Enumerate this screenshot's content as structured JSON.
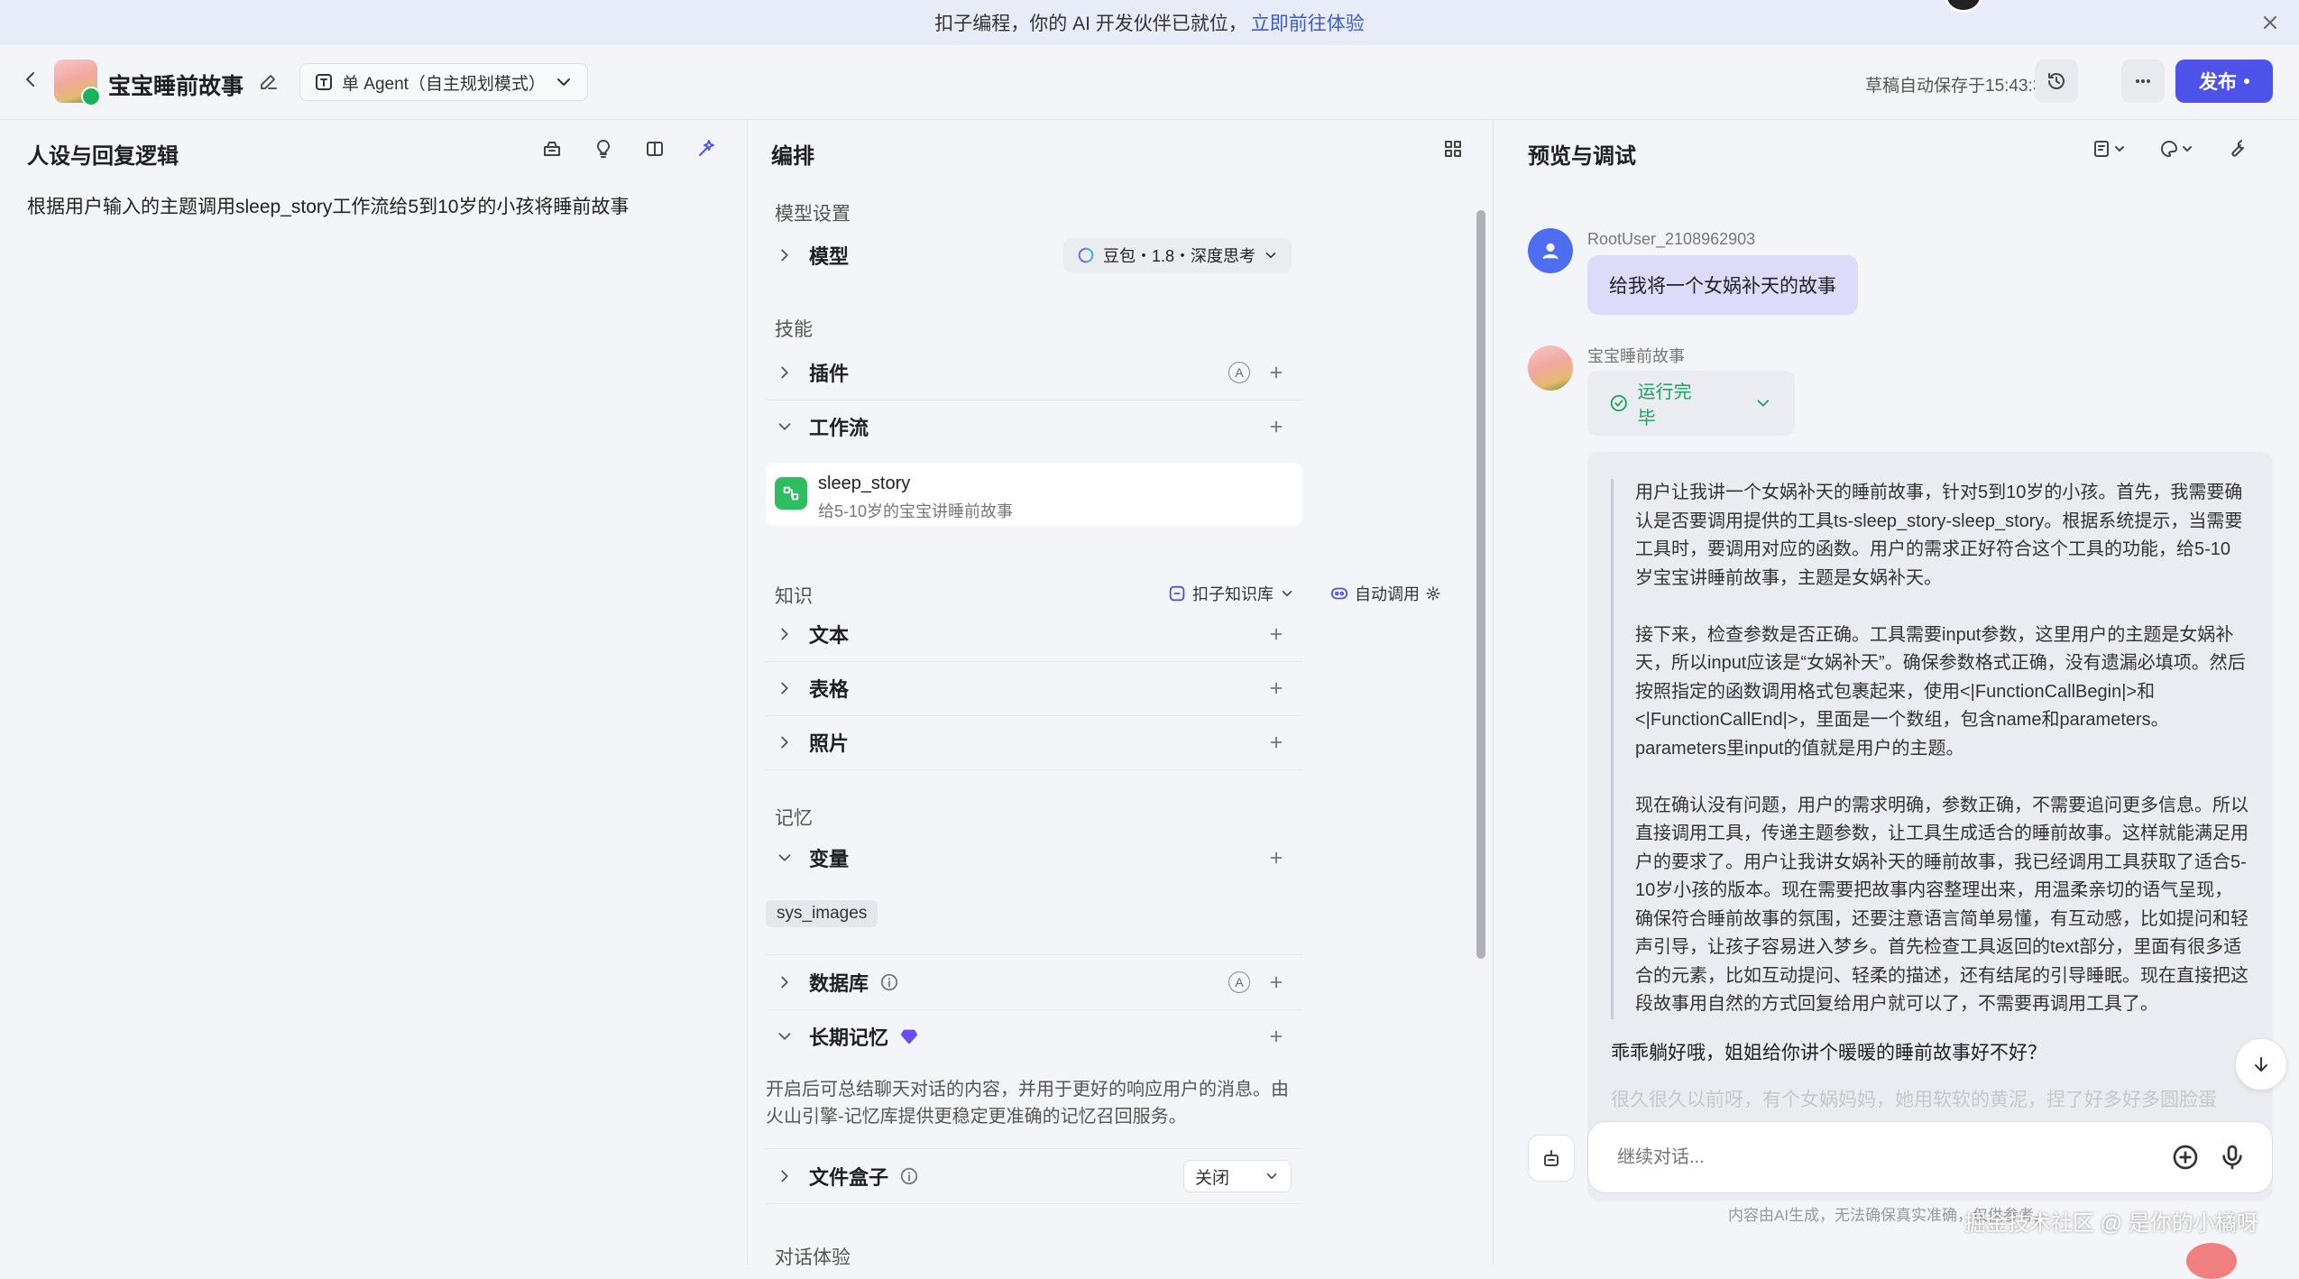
{
  "banner": {
    "text": "扣子编程，你的 AI 开发伙伴已就位，",
    "link": "立即前往体验"
  },
  "header": {
    "bot_name": "宝宝睡前故事",
    "mode": "单 Agent（自主规划模式）",
    "autosave": "草稿自动保存于15:43:34",
    "publish": "发布"
  },
  "persona": {
    "title": "人设与回复逻辑",
    "prompt": "根据用户输入的主题调用sleep_story工作流给5到10岁的小孩将睡前故事"
  },
  "arrange": {
    "title": "编排",
    "model_section": "模型设置",
    "model_label": "模型",
    "model_value": "豆包・1.8・深度思考",
    "skills_section": "技能",
    "plugins_label": "插件",
    "workflow_label": "工作流",
    "workflow": {
      "name": "sleep_story",
      "desc": "给5-10岁的宝宝讲睡前故事"
    },
    "knowledge_section": "知识",
    "kb_source": "扣子知识库",
    "kb_mode": "自动调用",
    "text_label": "文本",
    "table_label": "表格",
    "photo_label": "照片",
    "memory_section": "记忆",
    "variables_label": "变量",
    "variable_chip": "sys_images",
    "database_label": "数据库",
    "ltm_label": "长期记忆",
    "ltm_desc": "开启后可总结聊天对话的内容，并用于更好的响应用户的消息。由火山引擎-记忆库提供更稳定更准确的记忆召回服务。",
    "filebox_label": "文件盒子",
    "filebox_value": "关闭",
    "dialog_section": "对话体验"
  },
  "preview": {
    "title": "预览与调试",
    "user_name": "RootUser_2108962903",
    "user_message": "给我将一个女娲补天的故事",
    "bot_name": "宝宝睡前故事",
    "run_status": "运行完毕",
    "reasoning": [
      "用户让我讲一个女娲补天的睡前故事，针对5到10岁的小孩。首先，我需要确认是否要调用提供的工具ts-sleep_story-sleep_story。根据系统提示，当需要工具时，要调用对应的函数。用户的需求正好符合这个工具的功能，给5-10岁宝宝讲睡前故事，主题是女娲补天。",
      "接下来，检查参数是否正确。工具需要input参数，这里用户的主题是女娲补天，所以input应该是“女娲补天”。确保参数格式正确，没有遗漏必填项。然后按照指定的函数调用格式包裹起来，使用<|FunctionCallBegin|>和<|FunctionCallEnd|>，里面是一个数组，包含name和parameters。parameters里input的值就是用户的主题。",
      "现在确认没有问题，用户的需求明确，参数正确，不需要追问更多信息。所以直接调用工具，传递主题参数，让工具生成适合的睡前故事。这样就能满足用户的要求了。用户让我讲女娲补天的睡前故事，我已经调用工具获取了适合5-10岁小孩的版本。现在需要把故事内容整理出来，用温柔亲切的语气呈现，确保符合睡前故事的氛围，还要注意语言简单易懂，有互动感，比如提问和轻声引导，让孩子容易进入梦乡。首先检查工具返回的text部分，里面有很多适合的元素，比如互动提问、轻柔的描述，还有结尾的引导睡眠。现在直接把这段故事用自然的方式回复给用户就可以了，不需要再调用工具了。"
    ],
    "answer_line_1": "乖乖躺好哦，姐姐给你讲个暖暖的睡前故事好不好？",
    "answer_line_2": "很久很久以前呀，有个女娲妈妈，她用软软的黄泥，捏了好多好多圆脸蛋",
    "input_placeholder": "继续对话...",
    "disclaimer": "内容由AI生成，无法确保真实准确，仅供参考。",
    "watermark": "掘金技术社区 @ 是你的小橘呀"
  },
  "colors": {
    "accent": "#4d53e8",
    "success": "#19a35a",
    "workflow": "#2ebd5f",
    "user_avatar": "#4d6ef0"
  }
}
